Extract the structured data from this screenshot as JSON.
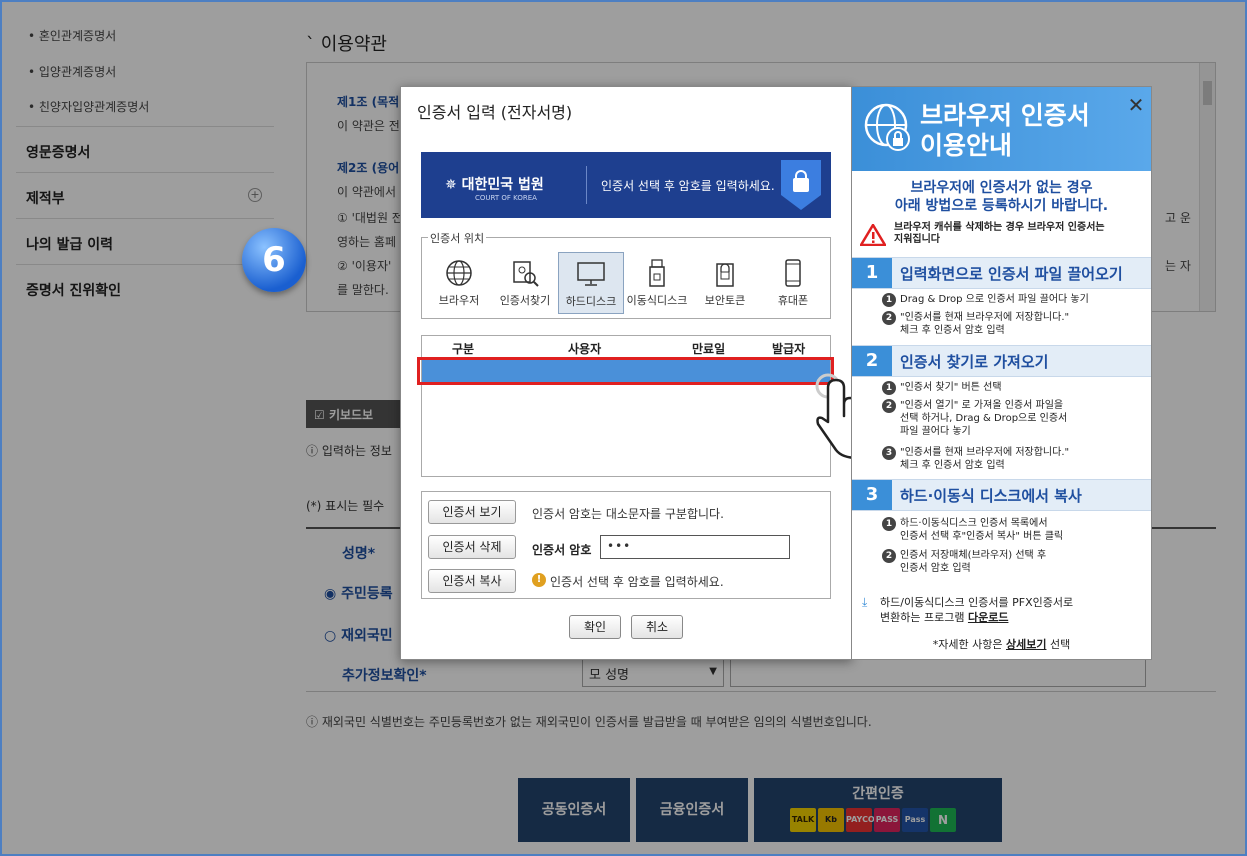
{
  "sidebar": {
    "sub_items": [
      "• 혼인관계증명서",
      "• 입양관계증명서",
      "• 친양자입양관계증명서"
    ],
    "main_items": [
      "영문증명서",
      "제적부",
      "나의 발급 이력",
      "증명서 진위확인"
    ],
    "step_badge": "6"
  },
  "terms": {
    "section_title": "이용약관",
    "lines": [
      {
        "text": "제1조 (목적",
        "heading": true
      },
      {
        "text": "이 약관은 전",
        "heading": false
      },
      {
        "text": "제2조 (용어",
        "heading": true
      },
      {
        "text": "이 약관에서",
        "heading": false
      },
      {
        "text": "① '대법원 전",
        "heading": false
      },
      {
        "text": "영하는 홈페",
        "heading": false
      },
      {
        "text": "② '이용자'",
        "heading": false
      },
      {
        "text": "를 말한다.",
        "heading": false
      }
    ],
    "right_fragments": [
      "고 운",
      "는 자"
    ]
  },
  "form": {
    "keyboard_label": "키보드보",
    "help_text": "입력하는 정보",
    "required_note": "(*) 표시는 필수",
    "name_label": "성명*",
    "resident_label": "주민등록",
    "foreign_label": "재외국민",
    "extra_label": "추가정보확인*",
    "select_value": "모 성명",
    "foreign_note": "재외국민 식별번호는 주민등록번호가 없는 재외국민이 인증서를 발급받을 때 부여받은 임의의 식별번호입니다.",
    "buttons": {
      "public_cert": "공동인증서",
      "financial_cert": "금융인증서",
      "easy_cert": "간편인증"
    },
    "easy_logos": [
      "TALK",
      "Kb",
      "PAYCO",
      "PASS",
      "Pass",
      "N"
    ]
  },
  "dialog": {
    "title": "인증서 입력 (전자서명)",
    "banner": {
      "logo": "대한민국 법원",
      "logo_sub": "COURT OF KOREA",
      "text": "인증서 선택 후 암호를 입력하세요."
    },
    "location_legend": "인증서 위치",
    "locations": [
      {
        "label": "브라우저",
        "icon": "globe-icon",
        "selected": false
      },
      {
        "label": "인증서찾기",
        "icon": "cert-search-icon",
        "selected": false
      },
      {
        "label": "하드디스크",
        "icon": "monitor-icon",
        "selected": true
      },
      {
        "label": "이동식디스크",
        "icon": "usb-icon",
        "selected": false
      },
      {
        "label": "보안토큰",
        "icon": "token-icon",
        "selected": false
      },
      {
        "label": "휴대폰",
        "icon": "phone-icon",
        "selected": false
      }
    ],
    "table_headers": [
      "구분",
      "사용자",
      "만료일",
      "발급자"
    ],
    "buttons": {
      "view": "인증서 보기",
      "delete": "인증서 삭제",
      "copy": "인증서 복사",
      "ok": "확인",
      "cancel": "취소"
    },
    "case_info": "인증서 암호는 대소문자를 구분합니다.",
    "pw_label": "인증서 암호",
    "pw_value": "•••",
    "warning": "인증서 선택 후 암호를 입력하세요."
  },
  "guide": {
    "title_line1": "브라우저 인증서",
    "title_line2": "이용안내",
    "subtitle_line1": "브라우저에 인증서가 없는 경우",
    "subtitle_line2": "아래 방법으로 등록하시기 바랍니다.",
    "caution_line1": "브라우저 캐쉬를 삭제하는 경우 브라우저 인증서는",
    "caution_line2": "지워집니다",
    "steps": [
      {
        "num": "1",
        "title": "입력화면으로 인증서 파일 끌어오기",
        "items": [
          {
            "num": "1",
            "lines": [
              "Drag & Drop 으로 인증서 파일 끌어다 놓기"
            ]
          },
          {
            "num": "2",
            "lines": [
              "\"인증서를 현재 브라우저에 저장합니다.\"",
              "체크 후 인증서 암호 입력"
            ]
          }
        ]
      },
      {
        "num": "2",
        "title": "인증서 찾기로 가져오기",
        "items": [
          {
            "num": "1",
            "lines": [
              "\"인증서 찾기\" 버튼 선택"
            ]
          },
          {
            "num": "2",
            "lines": [
              "\"인증서 열기\" 로 가져올 인증서 파일을",
              "선택 하거나, Drag & Drop으로 인증서",
              "파일 끌어다 놓기"
            ]
          },
          {
            "num": "3",
            "lines": [
              "\"인증서를 현재 브라우저에 저장합니다.\"",
              "체크 후 인증서 암호 입력"
            ]
          }
        ]
      },
      {
        "num": "3",
        "title": "하드·이동식 디스크에서 복사",
        "items": [
          {
            "num": "1",
            "lines": [
              "하드·이동식디스크 인증서 목록에서",
              "인증서 선택 후\"인증서 복사\" 버튼 클릭"
            ]
          },
          {
            "num": "2",
            "lines": [
              "인증서 저장매체(브라우저) 선택 후",
              "인증서 암호 입력"
            ]
          }
        ]
      }
    ],
    "download_line1": "하드/이동식디스크 인증서를 PFX인증서로",
    "download_line2_pre": "변환하는 프로그램 ",
    "download_link": "다운로드",
    "detail_pre": "*자세한 사항은 ",
    "detail_link": "상세보기",
    "detail_post": " 선택"
  }
}
